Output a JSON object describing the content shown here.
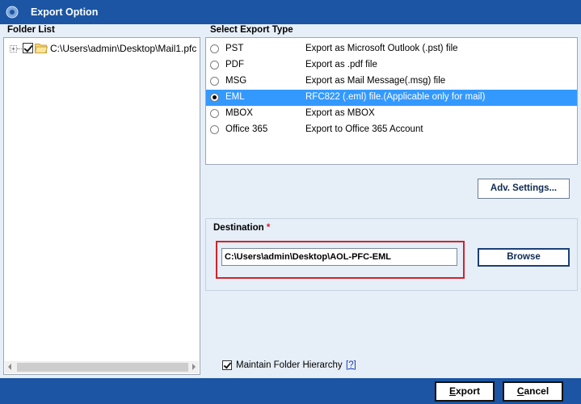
{
  "window": {
    "title": "Export Option",
    "icon": "gear-icon"
  },
  "folder_list": {
    "header": "Folder List",
    "items": [
      {
        "label": "C:\\Users\\admin\\Desktop\\Mail1.pfc",
        "checked": true,
        "expanded": false
      }
    ]
  },
  "export_type": {
    "header": "Select Export Type",
    "selected_index": 3,
    "options": [
      {
        "name": "PST",
        "description": "Export as Microsoft Outlook (.pst) file"
      },
      {
        "name": "PDF",
        "description": "Export as .pdf file"
      },
      {
        "name": "MSG",
        "description": "Export as Mail Message(.msg) file"
      },
      {
        "name": "EML",
        "description": "RFC822 (.eml) file.(Applicable only for mail)"
      },
      {
        "name": "MBOX",
        "description": "Export as MBOX"
      },
      {
        "name": "Office 365",
        "description": "Export to Office 365 Account"
      }
    ]
  },
  "advanced": {
    "button_label": "Adv. Settings..."
  },
  "destination": {
    "label": "Destination",
    "required_marker": "*",
    "path": "C:\\Users\\admin\\Desktop\\AOL-PFC-EML",
    "browse_label": "Browse"
  },
  "hierarchy": {
    "label": "Maintain Folder Hierarchy",
    "help_link": "[?]",
    "checked": true
  },
  "footer": {
    "export_label": "Export",
    "cancel_label": "Cancel"
  },
  "colors": {
    "titlebar": "#1b55a3",
    "panel_bg": "#e6eef8",
    "selection": "#3399ff",
    "highlight_border": "#d2232a"
  }
}
